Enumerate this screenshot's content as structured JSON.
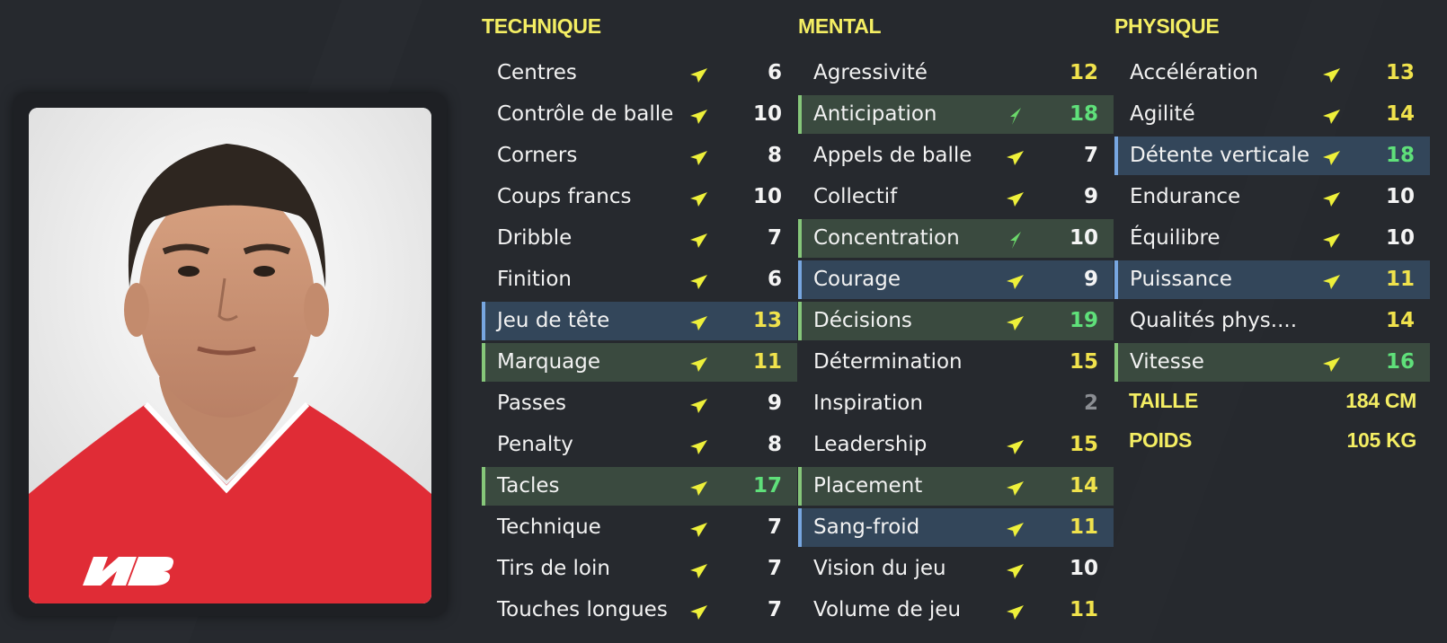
{
  "columns": [
    {
      "title": "TECHNIQUE",
      "rows": [
        {
          "label": "Centres",
          "value": "6",
          "color": "white",
          "arrow": "yellow",
          "hl": ""
        },
        {
          "label": "Contrôle de balle",
          "value": "10",
          "color": "white",
          "arrow": "yellow",
          "hl": ""
        },
        {
          "label": "Corners",
          "value": "8",
          "color": "white",
          "arrow": "yellow",
          "hl": ""
        },
        {
          "label": "Coups francs",
          "value": "10",
          "color": "white",
          "arrow": "yellow",
          "hl": ""
        },
        {
          "label": "Dribble",
          "value": "7",
          "color": "white",
          "arrow": "yellow",
          "hl": ""
        },
        {
          "label": "Finition",
          "value": "6",
          "color": "white",
          "arrow": "yellow",
          "hl": ""
        },
        {
          "label": "Jeu de tête",
          "value": "13",
          "color": "yellow",
          "arrow": "yellow",
          "hl": "blue"
        },
        {
          "label": "Marquage",
          "value": "11",
          "color": "yellow",
          "arrow": "yellow",
          "hl": "green"
        },
        {
          "label": "Passes",
          "value": "9",
          "color": "white",
          "arrow": "yellow",
          "hl": ""
        },
        {
          "label": "Penalty",
          "value": "8",
          "color": "white",
          "arrow": "yellow",
          "hl": ""
        },
        {
          "label": "Tacles",
          "value": "17",
          "color": "green",
          "arrow": "yellow",
          "hl": "green"
        },
        {
          "label": "Technique",
          "value": "7",
          "color": "white",
          "arrow": "yellow",
          "hl": ""
        },
        {
          "label": "Tirs de loin",
          "value": "7",
          "color": "white",
          "arrow": "yellow",
          "hl": ""
        },
        {
          "label": "Touches longues",
          "value": "7",
          "color": "white",
          "arrow": "yellow",
          "hl": ""
        }
      ]
    },
    {
      "title": "MENTAL",
      "rows": [
        {
          "label": "Agressivité",
          "value": "12",
          "color": "yellow",
          "arrow": "",
          "hl": ""
        },
        {
          "label": "Anticipation",
          "value": "18",
          "color": "green",
          "arrow": "green",
          "hl": "green"
        },
        {
          "label": "Appels de balle",
          "value": "7",
          "color": "white",
          "arrow": "yellow",
          "hl": ""
        },
        {
          "label": "Collectif",
          "value": "9",
          "color": "white",
          "arrow": "yellow",
          "hl": ""
        },
        {
          "label": "Concentration",
          "value": "10",
          "color": "white",
          "arrow": "green",
          "hl": "green"
        },
        {
          "label": "Courage",
          "value": "9",
          "color": "white",
          "arrow": "yellow",
          "hl": "blue"
        },
        {
          "label": "Décisions",
          "value": "19",
          "color": "green",
          "arrow": "yellow",
          "hl": "green"
        },
        {
          "label": "Détermination",
          "value": "15",
          "color": "yellow",
          "arrow": "",
          "hl": ""
        },
        {
          "label": "Inspiration",
          "value": "2",
          "color": "grey",
          "arrow": "",
          "hl": ""
        },
        {
          "label": "Leadership",
          "value": "15",
          "color": "yellow",
          "arrow": "yellow",
          "hl": ""
        },
        {
          "label": "Placement",
          "value": "14",
          "color": "yellow",
          "arrow": "yellow",
          "hl": "green"
        },
        {
          "label": "Sang-froid",
          "value": "11",
          "color": "yellow",
          "arrow": "yellow",
          "hl": "blue"
        },
        {
          "label": "Vision du jeu",
          "value": "10",
          "color": "white",
          "arrow": "yellow",
          "hl": ""
        },
        {
          "label": "Volume de jeu",
          "value": "11",
          "color": "yellow",
          "arrow": "yellow",
          "hl": ""
        }
      ]
    },
    {
      "title": "PHYSIQUE",
      "rows": [
        {
          "label": "Accélération",
          "value": "13",
          "color": "yellow",
          "arrow": "yellow",
          "hl": ""
        },
        {
          "label": "Agilité",
          "value": "14",
          "color": "yellow",
          "arrow": "yellow",
          "hl": ""
        },
        {
          "label": "Détente verticale",
          "value": "18",
          "color": "green",
          "arrow": "yellow",
          "hl": "blue"
        },
        {
          "label": "Endurance",
          "value": "10",
          "color": "white",
          "arrow": "yellow",
          "hl": ""
        },
        {
          "label": "Équilibre",
          "value": "10",
          "color": "white",
          "arrow": "yellow",
          "hl": ""
        },
        {
          "label": "Puissance",
          "value": "11",
          "color": "yellow",
          "arrow": "yellow",
          "hl": "blue"
        },
        {
          "label": "Qualités phys....",
          "value": "14",
          "color": "yellow",
          "arrow": "",
          "hl": ""
        },
        {
          "label": "Vitesse",
          "value": "16",
          "color": "green",
          "arrow": "yellow",
          "hl": "green"
        }
      ]
    }
  ],
  "meta": {
    "height_label": "TAILLE",
    "height_value": "184 CM",
    "weight_label": "POIDS",
    "weight_value": "105 KG"
  },
  "colors": {
    "background": "#26292e",
    "title_yellow": "#f4ee63",
    "value_yellow": "#f0e24c",
    "value_green": "#5fe07a",
    "value_grey": "#8b8e93",
    "arrow_yellow": "#eef03a",
    "arrow_green": "#6bd86a",
    "highlight_green": "#3a4a3f",
    "highlight_blue": "#33465a",
    "kit_red": "#e02c36"
  },
  "icons": {
    "arrow": "trend-arrow-icon",
    "brand": "new-balance-logo"
  }
}
